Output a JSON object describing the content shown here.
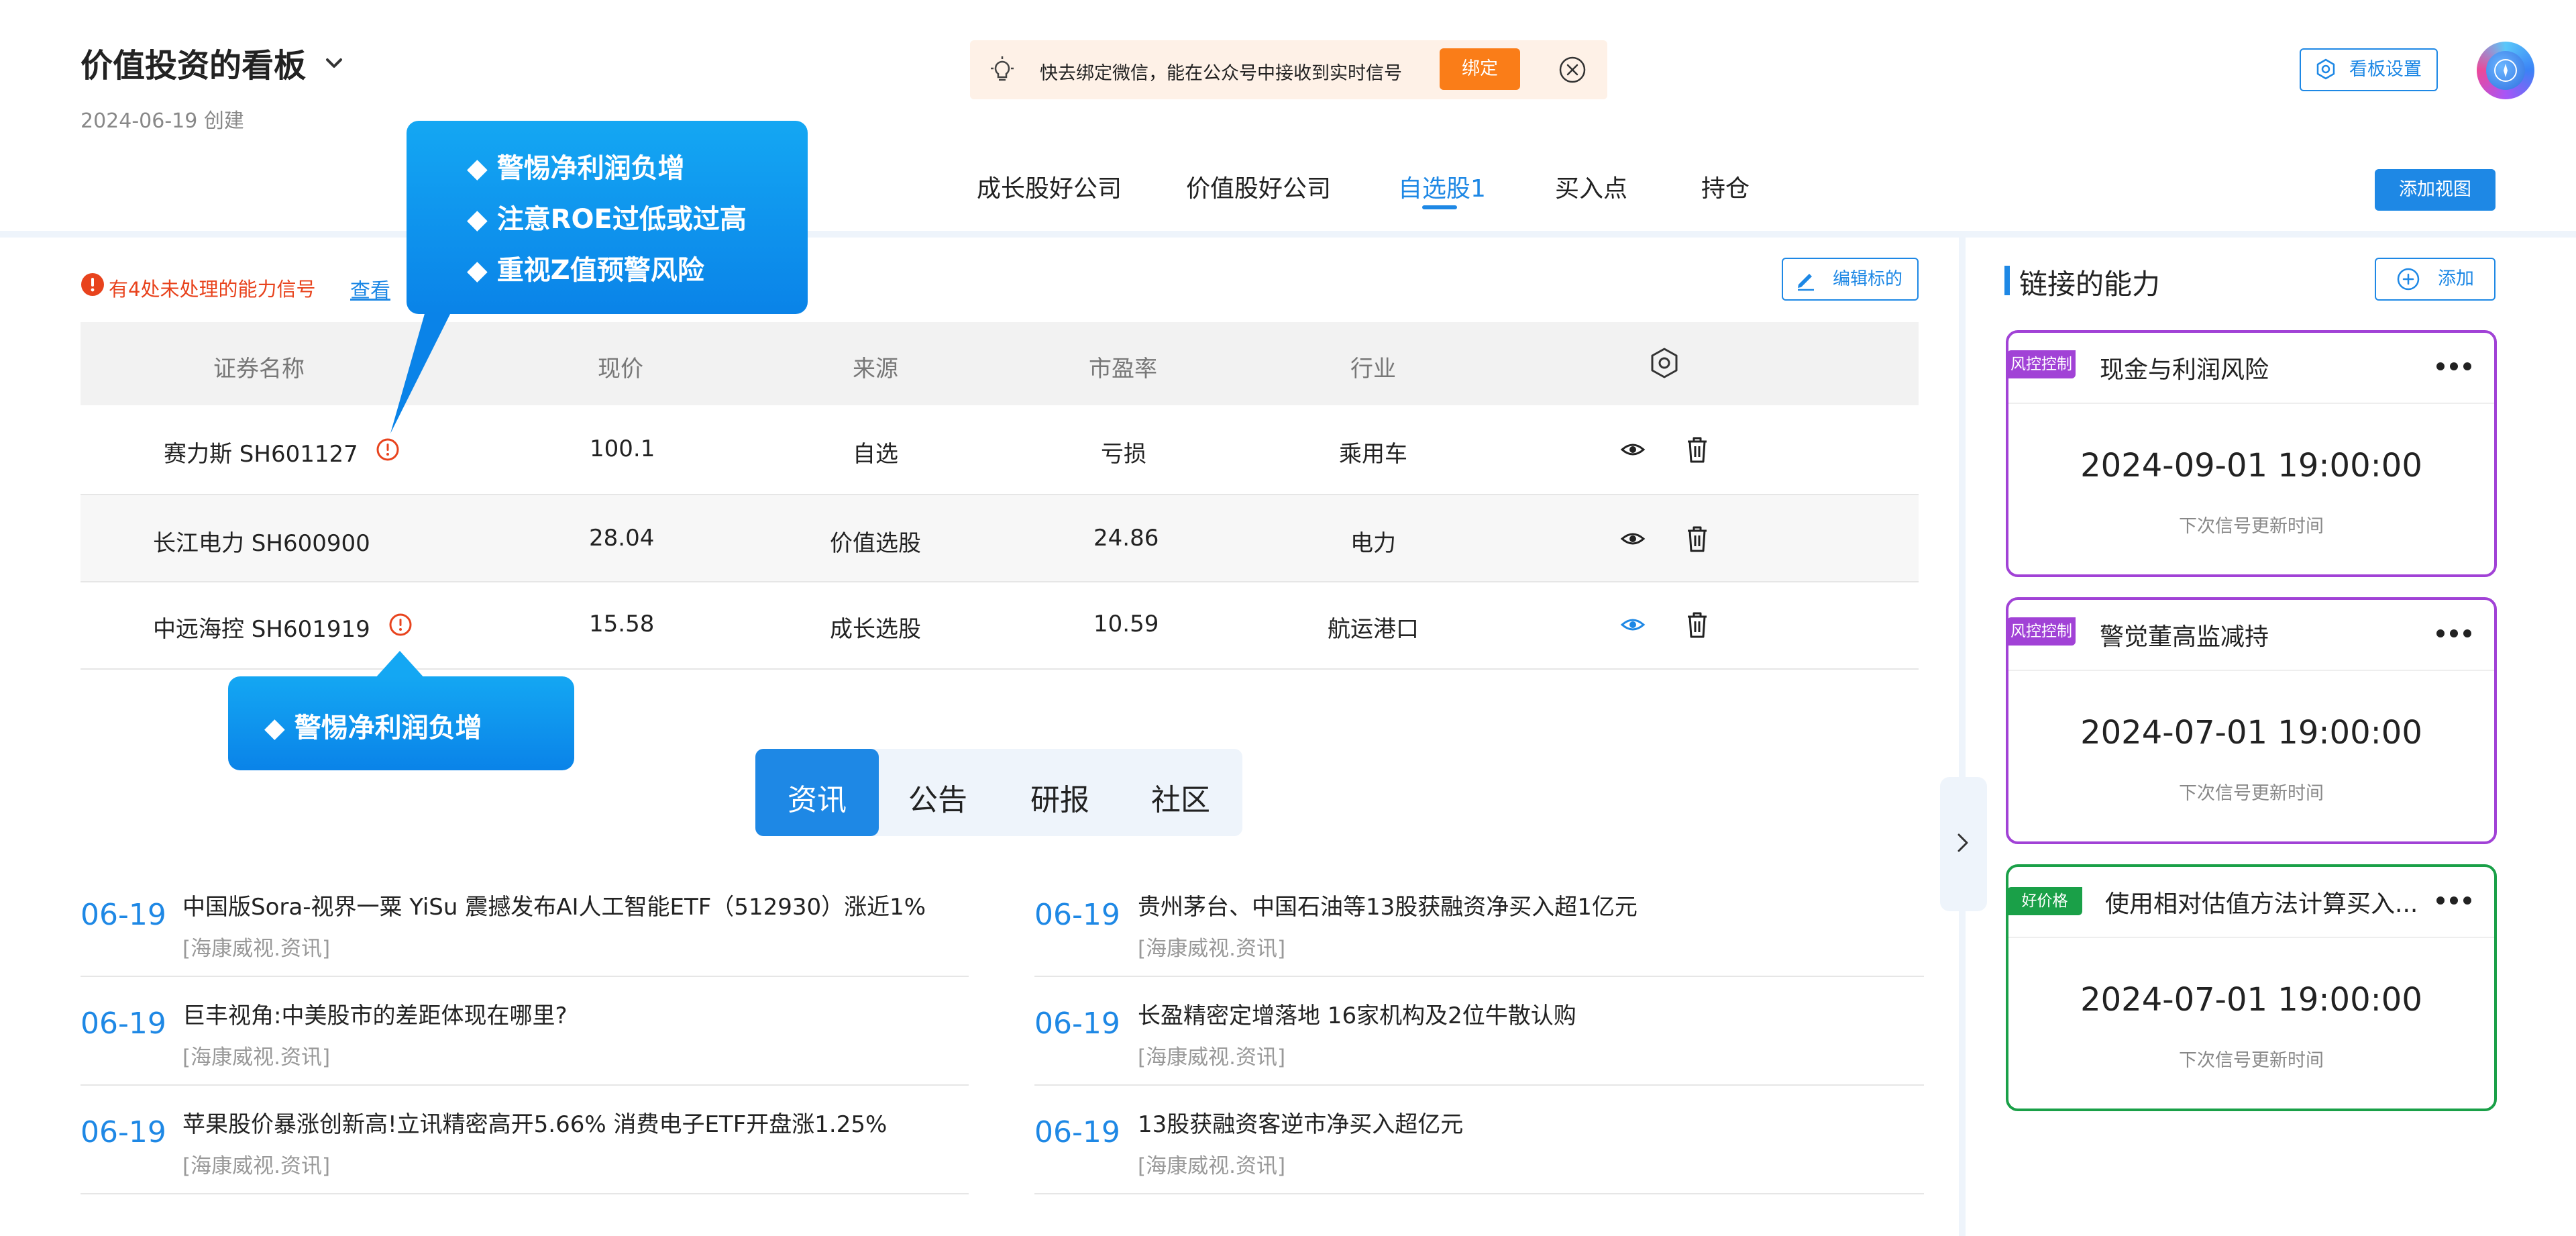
{
  "header": {
    "title": "价值投资的看板",
    "created": "2024-06-19 创建",
    "notice": {
      "text": "快去绑定微信，能在公众号中接收到实时信号",
      "bind_label": "绑定"
    },
    "board_settings_label": "看板设置"
  },
  "tabs": [
    "成长股好公司",
    "价值股好公司",
    "自选股1",
    "买入点",
    "持仓"
  ],
  "active_tab": "自选股1",
  "add_view_label": "添加视图",
  "signal": {
    "text": "有4处未处理的能力信号",
    "link": "查看"
  },
  "edit_label": "编辑标的",
  "table": {
    "headers": [
      "证券名称",
      "现价",
      "来源",
      "市盈率",
      "行业"
    ],
    "rows": [
      {
        "name": "赛力斯 SH601127",
        "price": "100.1",
        "source": "自选",
        "pe": "亏损",
        "industry": "乘用车"
      },
      {
        "name": "长江电力 SH600900",
        "price": "28.04",
        "source": "价值选股",
        "pe": "24.86",
        "industry": "电力"
      },
      {
        "name": "中远海控 SH601919",
        "price": "15.58",
        "source": "成长选股",
        "pe": "10.59",
        "industry": "航运港口"
      }
    ]
  },
  "tooltip_main": [
    "警惕净利润负增",
    "注意ROE过低或过高",
    "重视Z值预警风险"
  ],
  "tooltip_small": [
    "警惕净利润负增"
  ],
  "content_tabs": [
    "资讯",
    "公告",
    "研报",
    "社区"
  ],
  "active_content_tab": "资讯",
  "news": {
    "left": [
      {
        "date": "06-19",
        "title": "中国版Sora-视界一粟 YiSu 震撼发布AI人工智能ETF（512930）涨近1%",
        "source": "[海康威视.资讯]"
      },
      {
        "date": "06-19",
        "title": "巨丰视角:中美股市的差距体现在哪里?",
        "source": "[海康威视.资讯]"
      },
      {
        "date": "06-19",
        "title": "苹果股价暴涨创新高!立讯精密高开5.66% 消费电子ETF开盘涨1.25%",
        "source": "[海康威视.资讯]"
      }
    ],
    "right": [
      {
        "date": "06-19",
        "title": "贵州茅台、中国石油等13股获融资净买入超1亿元",
        "source": "[海康威视.资讯]"
      },
      {
        "date": "06-19",
        "title": "长盈精密定增落地 16家机构及2位牛散认购",
        "source": "[海康威视.资讯]"
      },
      {
        "date": "06-19",
        "title": "13股获融资客逆市净买入超亿元",
        "source": "[海康威视.资讯]"
      }
    ]
  },
  "sidebar": {
    "title": "链接的能力",
    "add_label": "添加",
    "cards": [
      {
        "badge": "风控控制",
        "title": "现金与利润风险",
        "time": "2024-09-01 19:00:00",
        "subtitle": "下次信号更新时间",
        "color": "#a142d6"
      },
      {
        "badge": "风控控制",
        "title": "警觉董高监减持",
        "time": "2024-07-01 19:00:00",
        "subtitle": "下次信号更新时间",
        "color": "#a142d6"
      },
      {
        "badge": "好价格",
        "title": "使用相对估值方法计算买入...",
        "time": "2024-07-01 19:00:00",
        "subtitle": "下次信号更新时间",
        "color": "#1aa048"
      }
    ]
  },
  "colors": {
    "accent": "#1e88e5",
    "warning": "#e8431d",
    "bind": "#fa7d18",
    "risk": "#a142d6",
    "good": "#1aa048"
  }
}
